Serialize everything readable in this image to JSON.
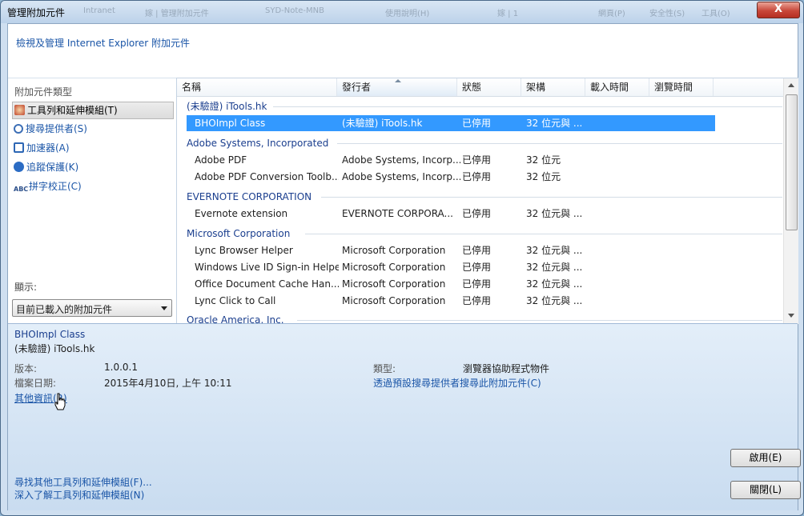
{
  "window": {
    "title": "管理附加元件",
    "close_label": "X",
    "ghost": [
      "Intranet",
      "嫁 | 管理附加元件",
      "SYD-Note-MNB",
      "使用說明(H)",
      "嫁 | 1",
      "網頁(P)",
      "安全性(S)",
      "工具(O)"
    ]
  },
  "header": {
    "text": "檢視及管理 Internet Explorer 附加元件"
  },
  "sidebar": {
    "title": "附加元件類型",
    "items": [
      {
        "label": "工具列和延伸模組(T)",
        "icon": "gear-icon",
        "selected": true
      },
      {
        "label": "搜尋提供者(S)",
        "icon": "search-icon",
        "selected": false
      },
      {
        "label": "加速器(A)",
        "icon": "accelerator-icon",
        "selected": false
      },
      {
        "label": "追蹤保護(K)",
        "icon": "no-entry-icon",
        "selected": false
      },
      {
        "label": "拼字校正(C)",
        "icon": "abc-spell-icon",
        "selected": false
      }
    ],
    "show_label": "顯示:",
    "show_value": "目前已載入的附加元件"
  },
  "list": {
    "columns": [
      "名稱",
      "發行者",
      "狀態",
      "架構",
      "載入時間",
      "瀏覽時間"
    ],
    "groups": [
      {
        "name": "(未驗證) iTools.hk",
        "rows": [
          {
            "name": "BHOImpl Class",
            "publisher": "(未驗證) iTools.hk",
            "status": "已停用",
            "arch": "32 位元與 ...",
            "selected": true
          }
        ]
      },
      {
        "name": "Adobe Systems, Incorporated",
        "rows": [
          {
            "name": "Adobe PDF",
            "publisher": "Adobe Systems, Incorp...",
            "status": "已停用",
            "arch": "32 位元"
          },
          {
            "name": "Adobe PDF Conversion Toolb...",
            "publisher": "Adobe Systems, Incorp...",
            "status": "已停用",
            "arch": "32 位元"
          }
        ]
      },
      {
        "name": "EVERNOTE CORPORATION",
        "rows": [
          {
            "name": "Evernote extension",
            "publisher": "EVERNOTE CORPORA...",
            "status": "已停用",
            "arch": "32 位元與 ..."
          }
        ]
      },
      {
        "name": "Microsoft Corporation",
        "rows": [
          {
            "name": "Lync Browser Helper",
            "publisher": "Microsoft Corporation",
            "status": "已停用",
            "arch": "32 位元與 ..."
          },
          {
            "name": "Windows Live ID Sign-in Helper",
            "publisher": "Microsoft Corporation",
            "status": "已停用",
            "arch": "32 位元與 ..."
          },
          {
            "name": "Office Document Cache Han...",
            "publisher": "Microsoft Corporation",
            "status": "已停用",
            "arch": "32 位元與 ..."
          },
          {
            "name": "Lync Click to Call",
            "publisher": "Microsoft Corporation",
            "status": "已停用",
            "arch": "32 位元與 ..."
          }
        ]
      },
      {
        "name": "Oracle America, Inc.",
        "rows": []
      }
    ]
  },
  "details": {
    "name": "BHOImpl Class",
    "publisher": "(未驗證) iTools.hk",
    "version_label": "版本:",
    "version": "1.0.0.1",
    "date_label": "檔案日期:",
    "date": "2015年4月10日, 上午 10:11",
    "more_info": "其他資訊(R)",
    "type_label": "類型:",
    "type": "瀏覽器協助程式物件",
    "search_link": "透過預設搜尋提供者搜尋此附加元件(C)"
  },
  "footer": {
    "find_more": "尋找其他工具列和延伸模組(F)...",
    "learn_more": "深入了解工具列和延伸模組(N)",
    "enable_button": "啟用(E)",
    "close_button": "關閉(L)"
  },
  "colors": {
    "selection": "#3399ff",
    "link": "#1a55a7",
    "group": "#1a3e8e"
  }
}
